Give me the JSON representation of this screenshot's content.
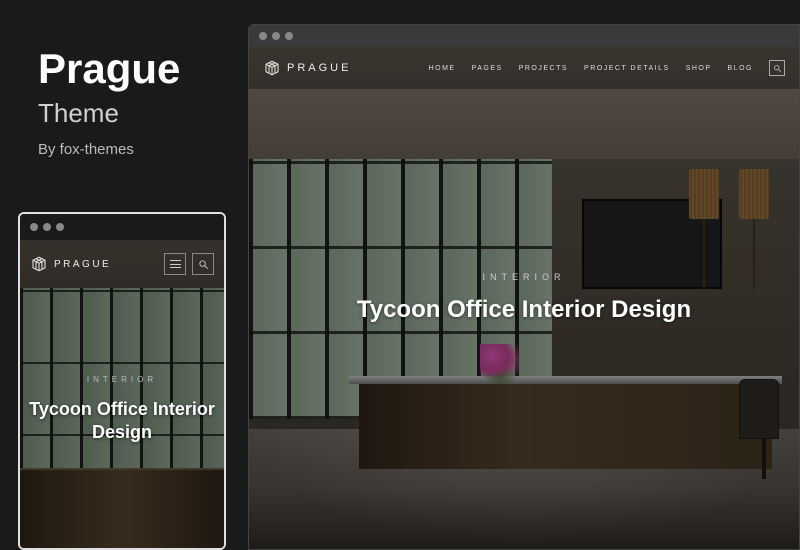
{
  "info": {
    "title": "Prague",
    "subtitle": "Theme",
    "author": "By fox-themes"
  },
  "brand": {
    "name": "PRAGUE"
  },
  "nav": {
    "items": [
      "HOME",
      "PAGES",
      "PROJECTS",
      "PROJECT DETAILS",
      "SHOP",
      "BLOG"
    ]
  },
  "hero": {
    "eyebrow": "INTERIOR",
    "title": "Tycoon Office Interior Design"
  }
}
